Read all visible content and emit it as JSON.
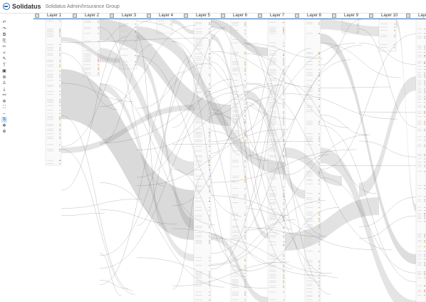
{
  "app": {
    "brand": "Solidatus",
    "breadcrumb": "Solidatus Admin/Insurance Group"
  },
  "layers": [
    {
      "label": "Layer 1"
    },
    {
      "label": "Layer 2"
    },
    {
      "label": "Layer 3"
    },
    {
      "label": "Layer 4"
    },
    {
      "label": "Layer 5"
    },
    {
      "label": "Layer 6"
    },
    {
      "label": "Layer 7"
    },
    {
      "label": "Layer 8"
    },
    {
      "label": "Layer 9"
    },
    {
      "label": "Layer 10"
    },
    {
      "label": "Laye"
    }
  ],
  "toolbar": {
    "tools": [
      {
        "icon": "undo-icon",
        "glyph": "↶"
      },
      {
        "icon": "redo-icon",
        "glyph": "↷"
      },
      {
        "icon": "copy-icon",
        "glyph": "⧉"
      },
      {
        "icon": "paste-icon",
        "glyph": "⎘"
      },
      {
        "icon": "scissors-icon",
        "glyph": "✂"
      },
      {
        "icon": "share-icon",
        "glyph": "<"
      },
      {
        "icon": "pencil-icon",
        "glyph": "✎"
      },
      {
        "icon": "text-icon",
        "glyph": "T"
      },
      {
        "icon": "image-icon",
        "glyph": "▣"
      },
      {
        "icon": "stack-icon",
        "glyph": "≣"
      },
      {
        "icon": "person-icon",
        "glyph": "♙"
      },
      {
        "icon": "download-icon",
        "glyph": "⤓"
      },
      {
        "icon": "link-icon",
        "glyph": "⚯"
      },
      {
        "icon": "gear-icon",
        "glyph": "✲"
      },
      {
        "icon": "expand-icon",
        "glyph": "⛶"
      },
      {
        "icon": "arrows-icon",
        "glyph": "⇔"
      },
      {
        "icon": "flow-icon",
        "glyph": "⇅"
      },
      {
        "icon": "move-icon",
        "glyph": "✥"
      },
      {
        "icon": "zoom-icon",
        "glyph": "⊕"
      }
    ]
  },
  "colors": {
    "accent": "#2a6db5",
    "flow": "#7a7a7a",
    "highlight": "#e7a82f",
    "green": "#5fb25f",
    "red": "#d66"
  }
}
